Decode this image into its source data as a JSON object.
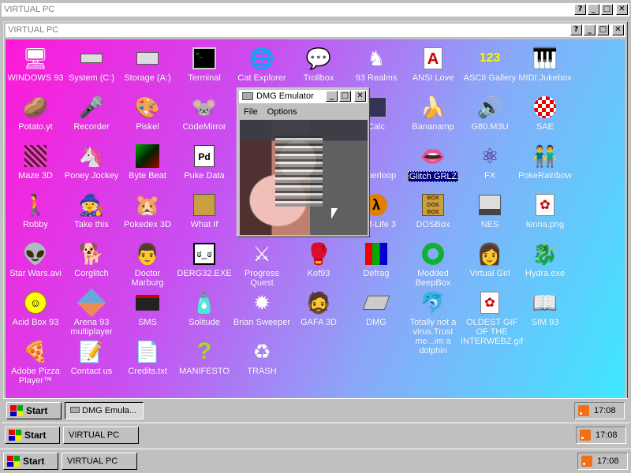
{
  "outer_window": {
    "title": "VIRTUAL PC"
  },
  "inner_window": {
    "title": "VIRTUAL PC"
  },
  "dialog": {
    "title": "DMG Emulator",
    "menu": [
      "File",
      "Options"
    ]
  },
  "title_buttons": {
    "help": "?",
    "minimize": "_",
    "maximize": "□",
    "close": "✕"
  },
  "taskbars": [
    {
      "start": "Start",
      "task": "DMG Emula...",
      "clock": "17:08"
    },
    {
      "start": "Start",
      "task": "VIRTUAL PC",
      "clock": "17:08"
    },
    {
      "start": "Start",
      "task": "VIRTUAL PC",
      "clock": "17:08"
    }
  ],
  "icons": [
    {
      "label": "WINDOWS 93",
      "icon": "computer-icon"
    },
    {
      "label": "System (C:)",
      "icon": "drive-icon"
    },
    {
      "label": "Storage (A:)",
      "icon": "floppy-drive-icon"
    },
    {
      "label": "Terminal",
      "icon": "terminal-icon"
    },
    {
      "label": "Cat Explorer",
      "icon": "globe-cat-icon"
    },
    {
      "label": "Trollbox",
      "icon": "chat-icon"
    },
    {
      "label": "93 Realms",
      "icon": "knight-icon"
    },
    {
      "label": "ANSI Love",
      "icon": "letter-a-icon"
    },
    {
      "label": "ASCII Gallery",
      "icon": "numbers-icon"
    },
    {
      "label": "MIDI Jukebox",
      "icon": "piano-icon"
    },
    {
      "label": "Potato.yt",
      "icon": "potato-icon"
    },
    {
      "label": "Recorder",
      "icon": "microphone-icon"
    },
    {
      "label": "Piskel",
      "icon": "palette-icon"
    },
    {
      "label": "CodeMirror",
      "icon": "codemirror-icon"
    },
    {
      "label": "Calc",
      "icon": "calculator-icon"
    },
    {
      "label": "Bananamp",
      "icon": "banana-icon"
    },
    {
      "label": "G80.M3U",
      "icon": "speaker-icon"
    },
    {
      "label": "SAE",
      "icon": "amiga-ball-icon"
    },
    {
      "label": "Maze 3D",
      "icon": "maze-icon"
    },
    {
      "label": "Poney Jockey",
      "icon": "pony-icon"
    },
    {
      "label": "Byte Beat",
      "icon": "bytebeat-icon"
    },
    {
      "label": "Puke Data",
      "icon": "pd-icon"
    },
    {
      "label": "Hyperloop",
      "icon": "hyperloop-icon"
    },
    {
      "label": "Glitch GRLZ",
      "icon": "lips-icon"
    },
    {
      "label": "FX",
      "icon": "atom-icon"
    },
    {
      "label": "PokeRainbow",
      "icon": "pokemon-trainers-icon"
    },
    {
      "label": "Robby",
      "icon": "stickman-icon"
    },
    {
      "label": "Take this",
      "icon": "take-this-icon"
    },
    {
      "label": "Pokedex 3D",
      "icon": "pokedex-icon"
    },
    {
      "label": "What If",
      "icon": "what-if-icon"
    },
    {
      "label": "Half-Life 3",
      "icon": "half-life-icon"
    },
    {
      "label": "DOSBox",
      "icon": "dosbox-icon"
    },
    {
      "label": "NES",
      "icon": "nes-icon"
    },
    {
      "label": "lenna.png",
      "icon": "image-file-icon"
    },
    {
      "label": "Star Wars.avi",
      "icon": "yoda-icon"
    },
    {
      "label": "Corglitch",
      "icon": "corgi-icon"
    },
    {
      "label": "Doctor Marburg",
      "icon": "doctor-icon"
    },
    {
      "label": "DERG32.EXE",
      "icon": "derg-icon"
    },
    {
      "label": "Progress Quest",
      "icon": "swords-icon"
    },
    {
      "label": "Kof93",
      "icon": "fighter-icon"
    },
    {
      "label": "Defrag",
      "icon": "defrag-icon"
    },
    {
      "label": "Modded BeepBox",
      "icon": "ring-icon"
    },
    {
      "label": "Virtual Girl",
      "icon": "girl-icon"
    },
    {
      "label": "Hydra.exe",
      "icon": "hydra-icon"
    },
    {
      "label": "Acid Box 93",
      "icon": "smiley-icon"
    },
    {
      "label": "Arena 93 multiplayer",
      "icon": "cube-icon"
    },
    {
      "label": "SMS",
      "icon": "sms-console-icon"
    },
    {
      "label": "Solitude",
      "icon": "solitude-icon"
    },
    {
      "label": "Brian Sweeper",
      "icon": "mine-icon"
    },
    {
      "label": "GAFA 3D",
      "icon": "gafa-face-icon"
    },
    {
      "label": "DMG",
      "icon": "gameboy-icon"
    },
    {
      "label": "Totally not a virus.Trust me...im a dolphin",
      "icon": "dolphin-icon"
    },
    {
      "label": "OLDEST GIF OF THE INTERWEBZ.gif",
      "icon": "gif-file-icon"
    },
    {
      "label": "SIM 93",
      "icon": "book-icon"
    },
    {
      "label": "Adobe Pizza Player™",
      "icon": "pizza-icon"
    },
    {
      "label": "Contact us",
      "icon": "contact-icon"
    },
    {
      "label": "Credits.txt",
      "icon": "text-file-icon"
    },
    {
      "label": "MANIFESTO",
      "icon": "question-mark-icon"
    },
    {
      "label": "TRASH",
      "icon": "recycle-bin-icon"
    }
  ]
}
